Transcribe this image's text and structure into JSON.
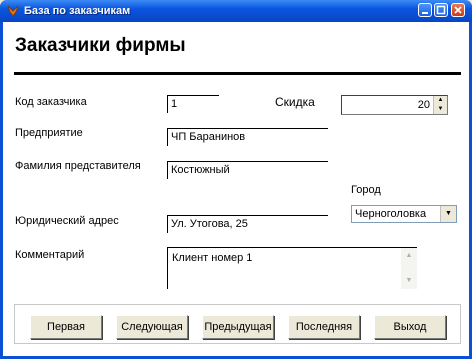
{
  "window": {
    "title": "База по заказчикам"
  },
  "form": {
    "heading": "Заказчики фирмы",
    "customer_code": {
      "label": "Код заказчика",
      "value": "1"
    },
    "discount": {
      "label": "Скидка",
      "value": "20"
    },
    "company": {
      "label": "Предприятие",
      "value": "ЧП Баранинов"
    },
    "representative": {
      "label": "Фамилия представителя",
      "value": "Костюжный"
    },
    "city": {
      "label": "Город",
      "value": "Черноголовка"
    },
    "legal_address": {
      "label": "Юридический адрес",
      "value": "Ул. Утогова, 25"
    },
    "comment": {
      "label": "Комментарий",
      "value": "Клиент номер 1"
    }
  },
  "buttons": {
    "first": "Первая",
    "next": "Следующая",
    "previous": "Предыдущая",
    "last": "Последняя",
    "exit": "Выход"
  }
}
